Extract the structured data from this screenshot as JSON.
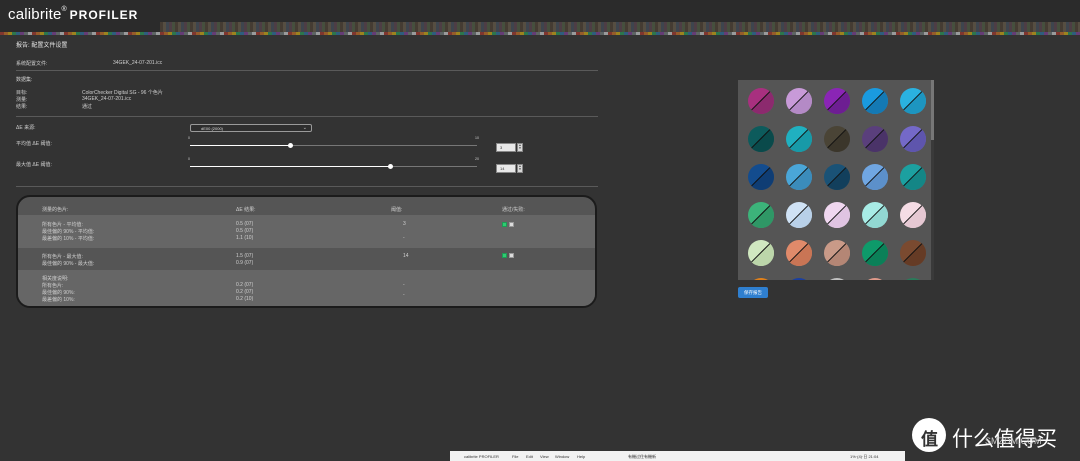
{
  "app": {
    "brand": "calibrite",
    "reg": "®",
    "product": "PROFILER"
  },
  "report": {
    "heading": "报告: 配置文件设置",
    "system_profile_label": "系统配置文件:",
    "system_profile_value": "34GEK_24-07-201.icc"
  },
  "dataset": {
    "label": "数据集:",
    "target_label": "目标:",
    "target_value": "ColorChecker Digital SG - 96 个色片",
    "meas_label": "测量:",
    "meas_value": "34GEK_24-07-201.icc",
    "result_label": "结果:",
    "result_value": "通过"
  },
  "settings": {
    "delta_e_label": "ΔE 来源:",
    "delta_e_value": "dE00 (2000)",
    "avg_label": "平均值 ΔE 阈值:",
    "avg_min": "0",
    "avg_max": "10",
    "avg_value": "3",
    "max_label": "最大值 ΔE 阈值:",
    "max_min": "0",
    "max_max": "20",
    "max_value": "14"
  },
  "table": {
    "headers": [
      "测量的色片:",
      "ΔE 结果:",
      "阈值:",
      "通过/失败:"
    ],
    "group1": {
      "labels": [
        "所有色片 - 平均值:",
        "最佳偏的 90% - 平均值:",
        "最差偏的 10% - 平均值:"
      ],
      "values": [
        "0.5 (07)",
        "0.5 (07)",
        "1.1 (10)"
      ],
      "threshold": [
        "3",
        "-",
        "-"
      ]
    },
    "group2": {
      "labels": [
        "所有色片 - 最大值:",
        "最佳偏的 90% - 最大值:"
      ],
      "values": [
        "1.5 (07)",
        "0.9 (07)"
      ],
      "threshold": [
        "14",
        "-"
      ]
    },
    "group3": {
      "labels": [
        "相关度说明:",
        "所有色片:",
        "最佳偏的 90%:",
        "最差偏的 10%:"
      ],
      "values": [
        "0.2 (07)",
        "0.2 (07)",
        "0.2 (10)"
      ],
      "threshold": [
        "-",
        "-"
      ]
    }
  },
  "swatches": [
    {
      "a": "#a8307f",
      "b": "#8c2a6e"
    },
    {
      "a": "#c89ad8",
      "b": "#b48ac6"
    },
    {
      "a": "#8a25b5",
      "b": "#6d1e92"
    },
    {
      "a": "#1a9adf",
      "b": "#1479b4"
    },
    {
      "a": "#2ab2e0",
      "b": "#1d95c0"
    },
    {
      "a": "#0d5b5c",
      "b": "#0a4a4b"
    },
    {
      "a": "#20b0c0",
      "b": "#179aa8"
    },
    {
      "a": "#4a4436",
      "b": "#3b362b"
    },
    {
      "a": "#5a3f7c",
      "b": "#4a3368"
    },
    {
      "a": "#7469c8",
      "b": "#5e55ad"
    },
    {
      "a": "#134c8e",
      "b": "#0f3d74"
    },
    {
      "a": "#4aa6d8",
      "b": "#3b8cbb"
    },
    {
      "a": "#1a5276",
      "b": "#123f5c"
    },
    {
      "a": "#70a6e2",
      "b": "#5c90ca"
    },
    {
      "a": "#1ca0a0",
      "b": "#148686"
    },
    {
      "a": "#3cb37a",
      "b": "#2f9766"
    },
    {
      "a": "#cfe2f5",
      "b": "#b8d0e8"
    },
    {
      "a": "#f0d7f0",
      "b": "#e0c4e2"
    },
    {
      "a": "#a8ece6",
      "b": "#92d8d2"
    },
    {
      "a": "#f5dce5",
      "b": "#e6c8d3"
    },
    {
      "a": "#d0e8c0",
      "b": "#bcd6aa"
    },
    {
      "a": "#e08a6a",
      "b": "#c97555"
    },
    {
      "a": "#c99a88",
      "b": "#b48675"
    },
    {
      "a": "#0e9a6a",
      "b": "#0b8058"
    },
    {
      "a": "#7a4a30",
      "b": "#653b25"
    },
    {
      "a": "#e0801a",
      "b": "#c26b12"
    },
    {
      "a": "#1a3fa0",
      "b": "#153487"
    },
    {
      "a": "#c0c0c0",
      "b": "#a9a9a9"
    },
    {
      "a": "#e09a8a",
      "b": "#c98677"
    },
    {
      "a": "#2a7a5a",
      "b": "#21644a"
    }
  ],
  "save_button": "保存报告",
  "taskbar": {
    "app": "calibrite PROFILER",
    "menus": [
      "File",
      "Edit",
      "View",
      "Window",
      "Help"
    ],
    "center": "有機过住有機新",
    "right": "1%·(4)·日 21:04"
  },
  "watermark": {
    "text": "什么值得买",
    "sub": "SMZDM.COM"
  }
}
